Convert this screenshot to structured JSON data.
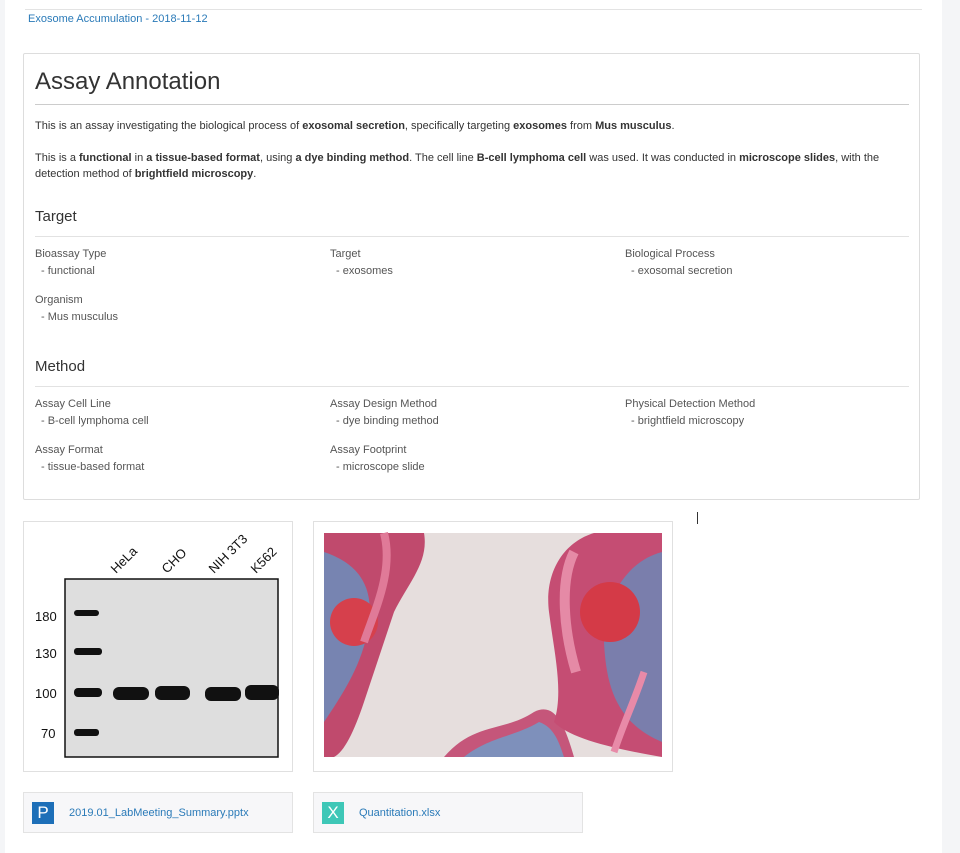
{
  "breadcrumb": "Exosome Accumulation - 2018-11-12",
  "title": "Assay Annotation",
  "description": {
    "p1": [
      {
        "t": "This is an assay investigating the biological process of ",
        "b": false
      },
      {
        "t": "exosomal secretion",
        "b": true
      },
      {
        "t": ", specifically targeting ",
        "b": false
      },
      {
        "t": "exosomes",
        "b": true
      },
      {
        "t": " from ",
        "b": false
      },
      {
        "t": "Mus musculus",
        "b": true
      },
      {
        "t": ".",
        "b": false
      }
    ],
    "p2": [
      {
        "t": "This is a ",
        "b": false
      },
      {
        "t": "functional",
        "b": true
      },
      {
        "t": " in ",
        "b": false
      },
      {
        "t": "a tissue-based format",
        "b": true
      },
      {
        "t": ", using ",
        "b": false
      },
      {
        "t": "a dye binding method",
        "b": true
      },
      {
        "t": ". The cell line ",
        "b": false
      },
      {
        "t": "B-cell lymphoma cell",
        "b": true
      },
      {
        "t": " was used. It was conducted in ",
        "b": false
      },
      {
        "t": "microscope slides",
        "b": true
      },
      {
        "t": ", with the detection method of ",
        "b": false
      },
      {
        "t": "brightfield microscopy",
        "b": true
      },
      {
        "t": ".",
        "b": false
      }
    ]
  },
  "target": {
    "heading": "Target",
    "fields": [
      {
        "label": "Bioassay Type",
        "value": "- functional"
      },
      {
        "label": "Target",
        "value": "- exosomes"
      },
      {
        "label": "Biological Process",
        "value": "- exosomal secretion"
      },
      {
        "label": "Organism",
        "value": "- Mus musculus"
      }
    ]
  },
  "method": {
    "heading": "Method",
    "fields": [
      {
        "label": "Assay Cell Line",
        "value": "- B-cell lymphoma cell"
      },
      {
        "label": "Assay Design Method",
        "value": "- dye binding method"
      },
      {
        "label": "Physical Detection Method",
        "value": "- brightfield microscopy"
      },
      {
        "label": "Assay Format",
        "value": "- tissue-based format"
      },
      {
        "label": "Assay Footprint",
        "value": "- microscope slide"
      }
    ]
  },
  "western_blot": {
    "lanes": [
      "HeLa",
      "CHO",
      "NIH 3T3",
      "K562"
    ],
    "markers": [
      "180",
      "130",
      "100",
      "70"
    ]
  },
  "files": [
    {
      "icon_letter": "P",
      "icon_color": "#1d6fb8",
      "name": "2019.01_LabMeeting_Summary.pptx",
      "icon": "powerpoint-file-icon"
    },
    {
      "icon_letter": "X",
      "icon_color": "#3ec7b7",
      "name": "Quantitation.xlsx",
      "icon": "excel-file-icon"
    }
  ],
  "colors": {
    "link": "#2a7ab8",
    "tissue_pink": "#d0486a",
    "tissue_blue": "#4a8fc0"
  }
}
